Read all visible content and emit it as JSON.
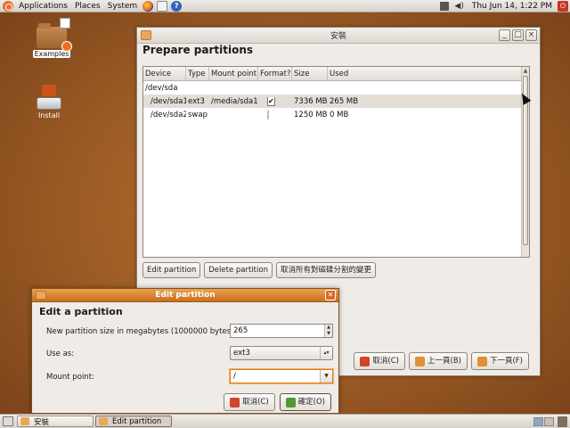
{
  "top_panel": {
    "menus": [
      "Applications",
      "Places",
      "System"
    ],
    "clock": "Thu Jun 14,  1:22 PM"
  },
  "desktop": {
    "icons": [
      {
        "label": "Examples"
      },
      {
        "label": "Install"
      }
    ]
  },
  "main_window": {
    "title": "安裝",
    "heading": "Prepare partitions",
    "controls": {
      "minimize": "_",
      "maximize": "□",
      "close": "×"
    },
    "table": {
      "columns": [
        "Device",
        "Type",
        "Mount point",
        "Format?",
        "Size",
        "Used"
      ],
      "group": "/dev/sda",
      "rows": [
        {
          "device": "/dev/sda1",
          "type": "ext3",
          "mount": "/media/sda1",
          "format": true,
          "size": "7336 MB",
          "used": "265 MB"
        },
        {
          "device": "/dev/sda2",
          "type": "swap",
          "mount": "",
          "format": false,
          "size": "1250 MB",
          "used": "0 MB"
        }
      ]
    },
    "buttons": {
      "edit": "Edit partition",
      "delete": "Delete partition",
      "undo": "取消所有對磁碟分割的變更"
    },
    "nav": {
      "cancel": "取消(C)",
      "back": "上一頁(B)",
      "forward": "下一頁(F)"
    }
  },
  "dialog": {
    "title": "Edit partition",
    "heading": "Edit a partition",
    "size_label": "New partition size in megabytes (1000000 bytes):",
    "size_value": "265",
    "use_as_label": "Use as:",
    "use_as_value": "ext3",
    "mount_label": "Mount point:",
    "mount_value": "/",
    "cancel": "取消(C)",
    "ok": "確定(O)"
  },
  "bottom_panel": {
    "tasks": [
      "安裝",
      "Edit partition"
    ]
  }
}
